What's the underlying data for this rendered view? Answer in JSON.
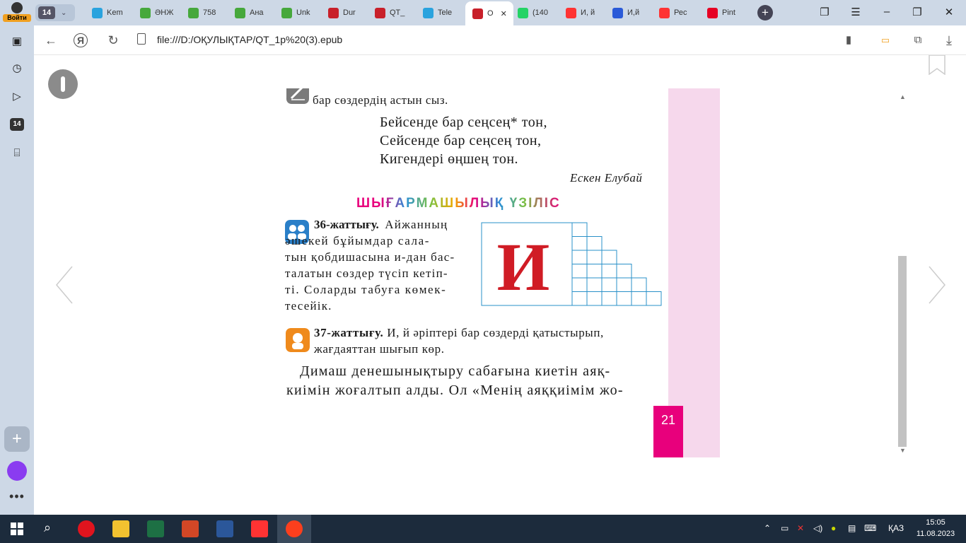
{
  "browser": {
    "login_label": "Войти",
    "tab_count": "14",
    "tabs": [
      {
        "label": "Kem",
        "color": "#2aa3de"
      },
      {
        "label": "ӘНЖ",
        "color": "#46a83c"
      },
      {
        "label": "758",
        "color": "#46a83c"
      },
      {
        "label": "Ана",
        "color": "#46a83c"
      },
      {
        "label": "Unk",
        "color": "#46a83c"
      },
      {
        "label": "Dur",
        "color": "#c8202a"
      },
      {
        "label": "QT_",
        "color": "#c8202a"
      },
      {
        "label": "Tele",
        "color": "#2aa3de"
      },
      {
        "label": "O",
        "color": "#c8202a"
      },
      {
        "label": "(140",
        "color": "#25d366"
      },
      {
        "label": "И, й",
        "color": "#f33"
      },
      {
        "label": "И,й",
        "color": "#2a5ad8"
      },
      {
        "label": "Рес",
        "color": "#f33"
      },
      {
        "label": "Pint",
        "color": "#e60023"
      }
    ],
    "url": "file:///D:/ОҚУЛЫҚТАР/QT_1p%20(3).epub",
    "sidebar_badge": "14"
  },
  "book": {
    "line_intro": "бар сөздердің астын сыз.",
    "poem": [
      "Бейсенде бар сеңсең* тон,",
      "Сейсенде бар сеңсең тон,",
      "Кигендері өңшең тон."
    ],
    "author": "Ескен Елубай",
    "section_title": "ШЫҒАРМАШЫЛЫҚ ҮЗІЛІС",
    "ex36": {
      "label": "36-жаттығу.",
      "lines": [
        "Айжанның",
        "әшекей бұйымдар сала-",
        "тын қобдишасына и-дан бас-",
        "талатын сөздер түсіп кетіп-",
        "ті. Соларды табуға көмек-",
        "тесейік."
      ]
    },
    "ex36_letter": "И",
    "ex37": {
      "label": "37-жаттығу.",
      "text": "И, й әріптері бар сөздерді қатыстырып,",
      "text2": "жағдаяттан шығып көр."
    },
    "para": [
      "Димаш денешынықтыру сабағына киетін аяқ-",
      "киімін жоғалтып алды. Ол «Менің аяққиімім жо-"
    ],
    "page_number": "21"
  },
  "taskbar": {
    "lang": "ҚАЗ",
    "time": "15:05",
    "date": "11.08.2023"
  }
}
